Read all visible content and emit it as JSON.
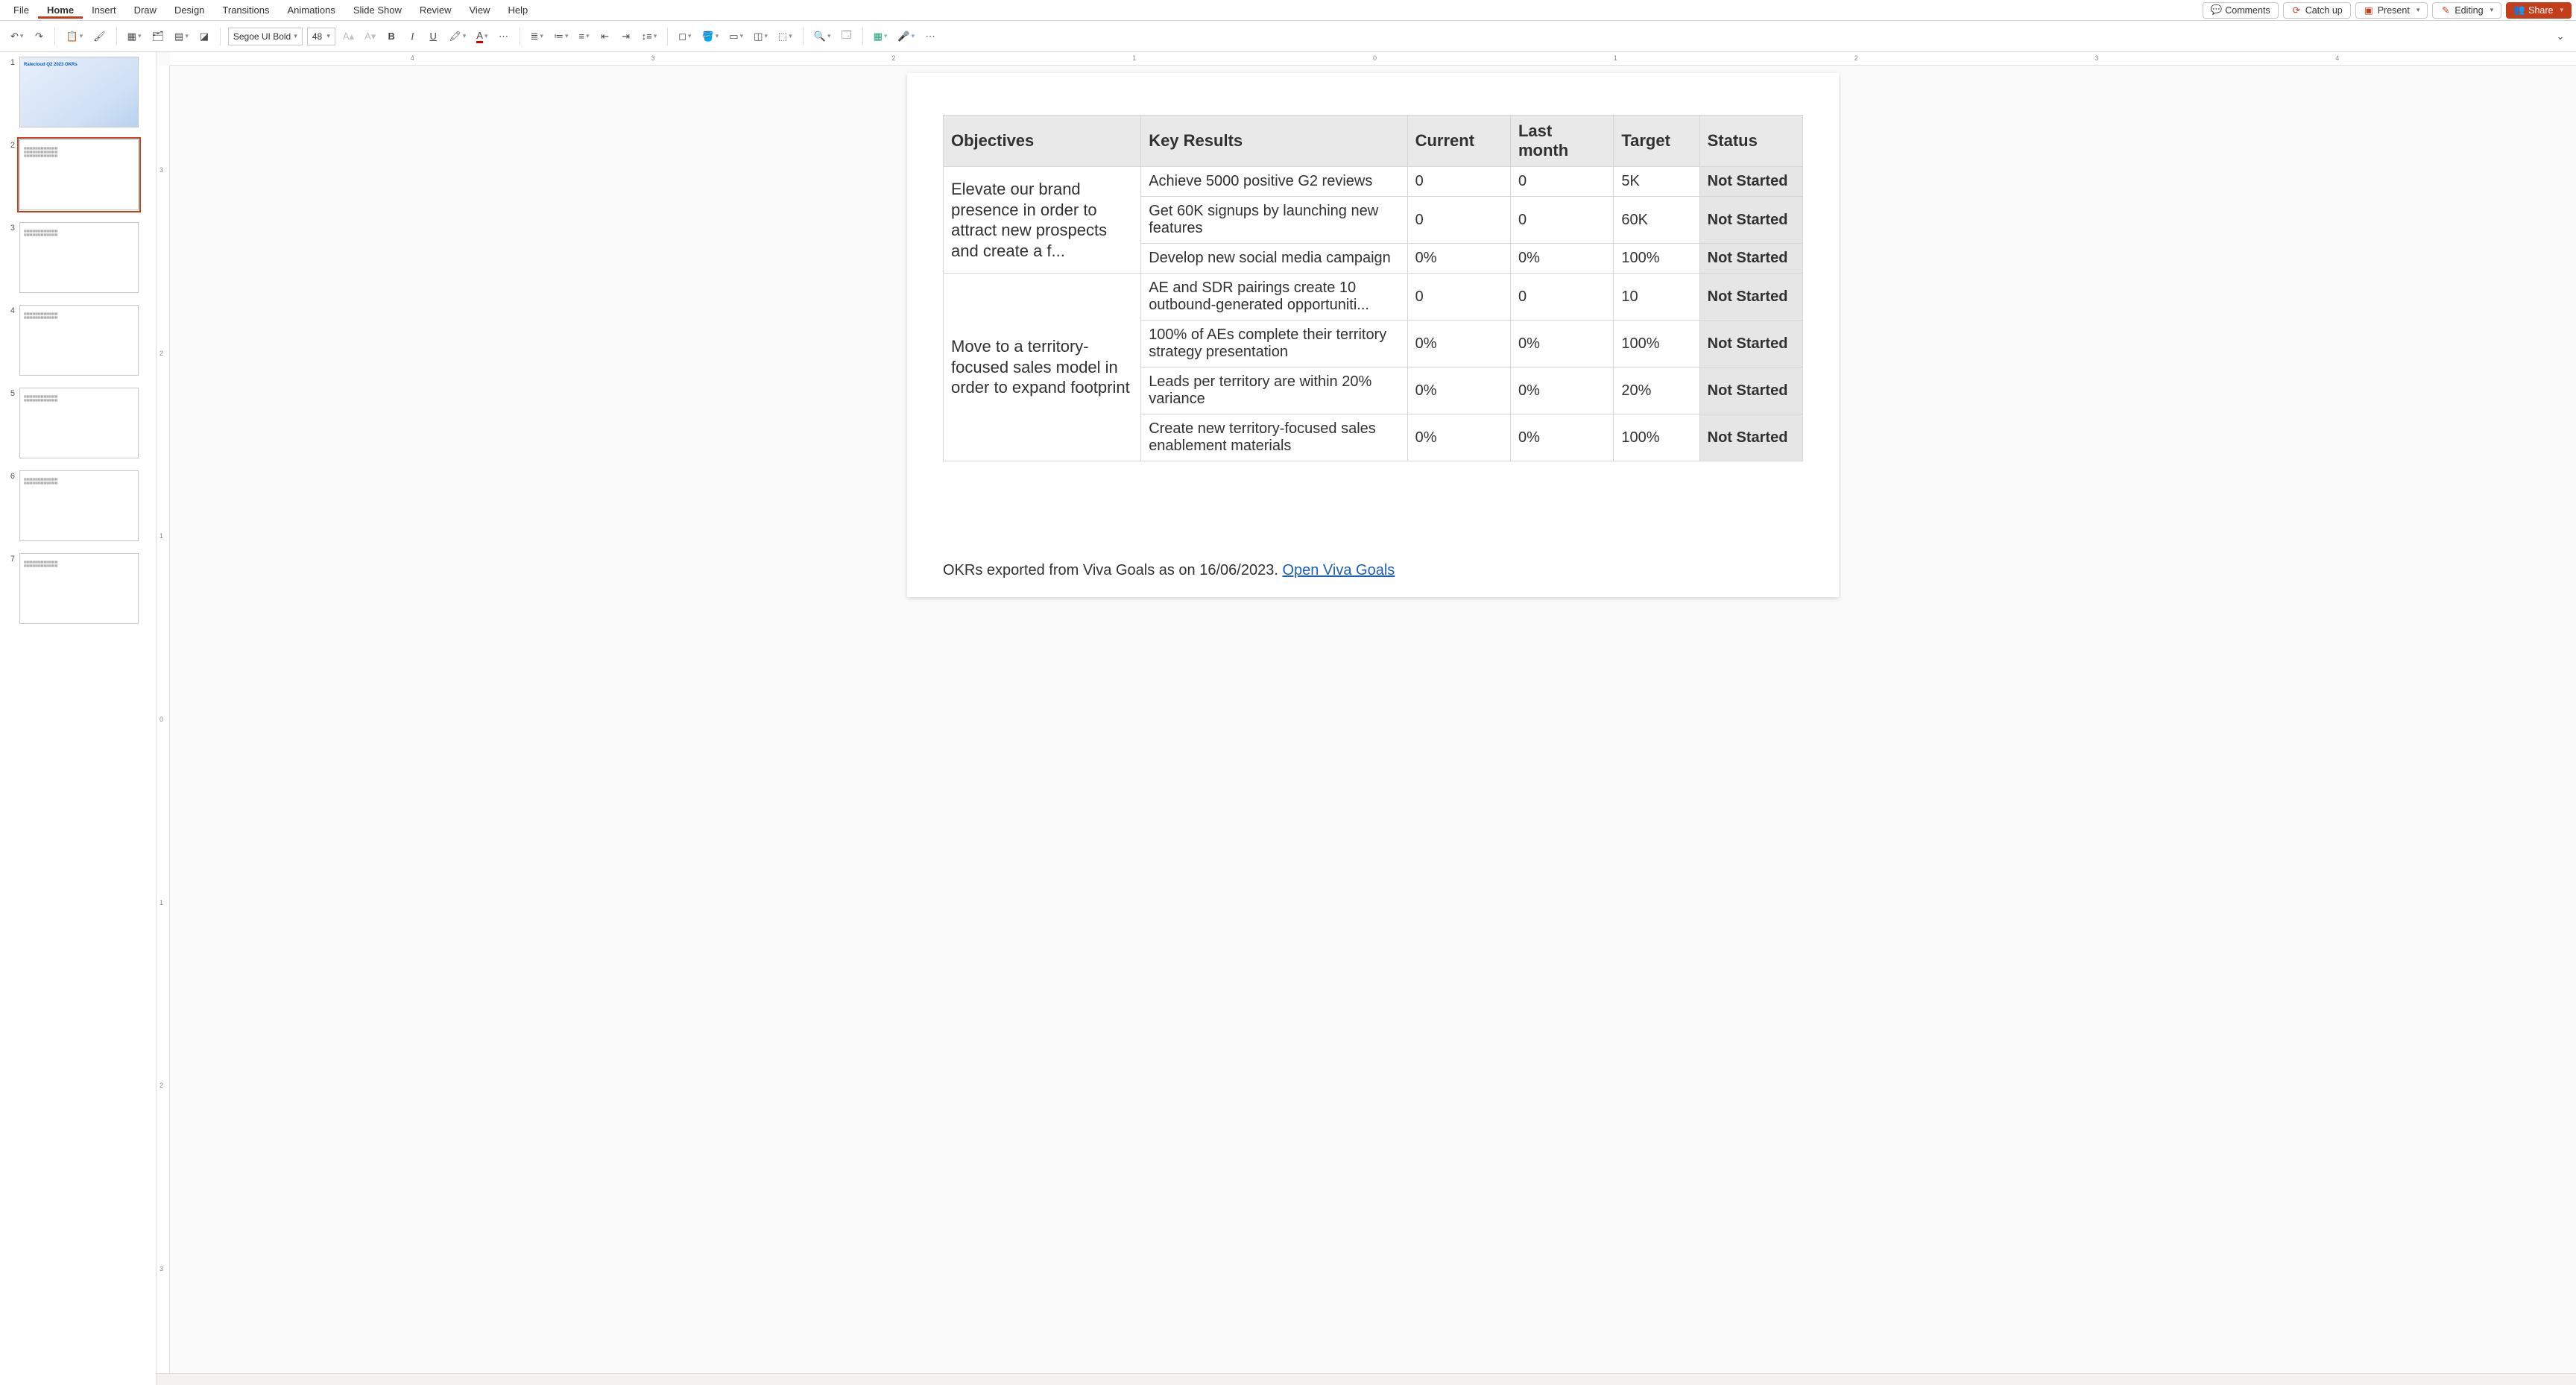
{
  "menu": {
    "tabs": [
      "File",
      "Home",
      "Insert",
      "Draw",
      "Design",
      "Transitions",
      "Animations",
      "Slide Show",
      "Review",
      "View",
      "Help"
    ],
    "active_index": 1,
    "actions": {
      "comments": "Comments",
      "catchup": "Catch up",
      "present": "Present",
      "editing": "Editing",
      "share": "Share"
    }
  },
  "ribbon": {
    "font_name": "Segoe UI Bold",
    "font_size": "48"
  },
  "ruler": {
    "h": [
      "4",
      "3",
      "2",
      "1",
      "0",
      "1",
      "2",
      "3",
      "4"
    ],
    "v": [
      "3",
      "2",
      "1",
      "0",
      "1",
      "2",
      "3"
    ]
  },
  "slides": {
    "selected_index": 1,
    "items": [
      {
        "title": "Ralecloud Q2 2023 OKRs",
        "type": "title"
      },
      {
        "type": "okr"
      },
      {
        "type": "okr"
      },
      {
        "type": "okr"
      },
      {
        "type": "okr"
      },
      {
        "type": "okr"
      },
      {
        "type": "okr"
      }
    ]
  },
  "okr_table": {
    "headers": [
      "Objectives",
      "Key Results",
      "Current",
      "Last month",
      "Target",
      "Status"
    ],
    "groups": [
      {
        "objective": "Elevate our brand presence in order to attract new prospects and create a f...",
        "rows": [
          {
            "kr": "Achieve 5000 positive G2 reviews",
            "current": "0",
            "last": "0",
            "target": "5K",
            "status": "Not Started"
          },
          {
            "kr": "Get 60K signups by launching new features",
            "current": "0",
            "last": "0",
            "target": "60K",
            "status": "Not Started"
          },
          {
            "kr": "Develop new social media campaign",
            "current": "0%",
            "last": "0%",
            "target": "100%",
            "status": "Not Started"
          }
        ]
      },
      {
        "objective": "Move to a territory-focused sales model in order to expand footprint",
        "rows": [
          {
            "kr": "AE and SDR pairings create 10 outbound-generated opportuniti...",
            "current": "0",
            "last": "0",
            "target": "10",
            "status": "Not Started"
          },
          {
            "kr": "100% of AEs complete their territory strategy presentation",
            "current": "0%",
            "last": "0%",
            "target": "100%",
            "status": "Not Started"
          },
          {
            "kr": "Leads per territory are within 20% variance",
            "current": "0%",
            "last": "0%",
            "target": "20%",
            "status": "Not Started"
          },
          {
            "kr": "Create new territory-focused sales enablement materials",
            "current": "0%",
            "last": "0%",
            "target": "100%",
            "status": "Not Started"
          }
        ]
      }
    ]
  },
  "footer": {
    "text": "OKRs exported from Viva Goals as on 16/06/2023. ",
    "link_text": "Open Viva Goals"
  }
}
